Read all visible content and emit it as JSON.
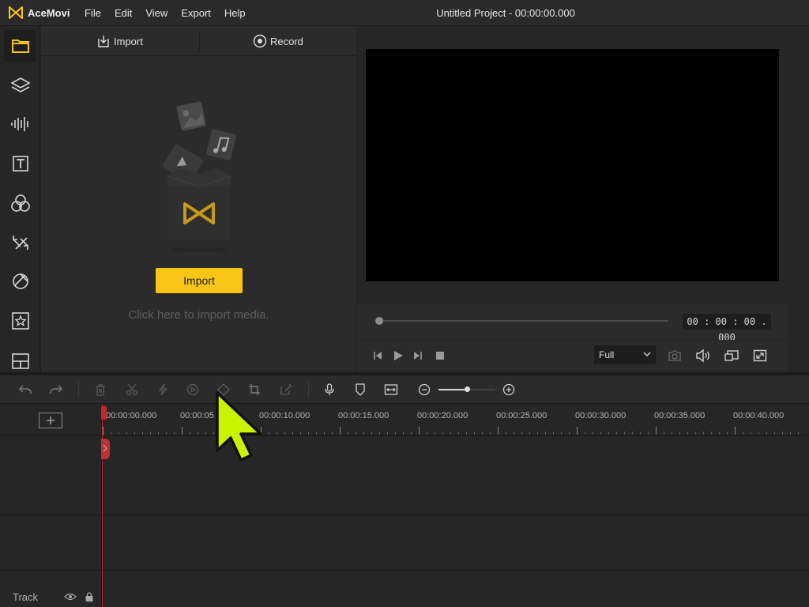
{
  "app": {
    "name": "AceMovi",
    "window_title": "Untitled Project - 00:00:00.000"
  },
  "menu": [
    "File",
    "Edit",
    "View",
    "Export",
    "Help"
  ],
  "rail": [
    {
      "name": "media-icon",
      "active": true
    },
    {
      "name": "layers-icon"
    },
    {
      "name": "audio-icon"
    },
    {
      "name": "text-icon"
    },
    {
      "name": "filters-icon"
    },
    {
      "name": "transitions-icon"
    },
    {
      "name": "effects-icon"
    },
    {
      "name": "elements-icon"
    },
    {
      "name": "layout-icon"
    }
  ],
  "media_panel": {
    "tabs": {
      "import": "Import",
      "record": "Record"
    },
    "import_button": "Import",
    "hint": "Click here to import media."
  },
  "preview": {
    "timecode": "00 : 00 : 00 . 000",
    "zoom": "Full",
    "progress": 0
  },
  "timeline": {
    "ruler_labels": [
      "00:00:00.000",
      "00:00:05",
      "00:00:10.000",
      "00:00:15.000",
      "00:00:20.000",
      "00:00:25.000",
      "00:00:30.000",
      "00:00:35.000",
      "00:00:40.000"
    ],
    "track_label": "Track"
  },
  "colors": {
    "accent": "#f8c517",
    "playhead": "#c2262a",
    "cursor": "#c8f400"
  }
}
